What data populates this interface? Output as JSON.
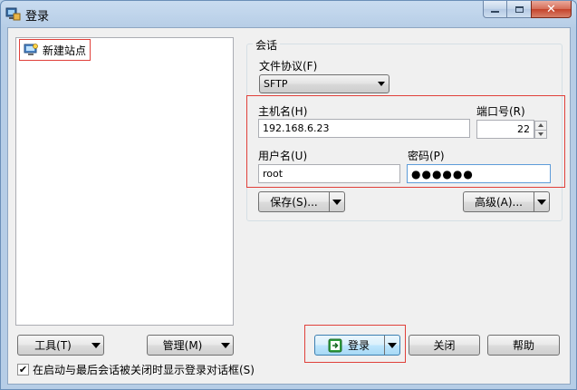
{
  "window": {
    "title": "登录"
  },
  "sites": {
    "new_site_label": "新建站点"
  },
  "session": {
    "group_label": "会话",
    "protocol_label": "文件协议(F)",
    "protocol_value": "SFTP",
    "host_label": "主机名(H)",
    "host_value": "192.168.6.23",
    "port_label": "端口号(R)",
    "port_value": "22",
    "user_label": "用户名(U)",
    "user_value": "root",
    "password_label": "密码(P)",
    "password_value": "●●●●●●",
    "save_label": "保存(S)...",
    "advanced_label": "高级(A)..."
  },
  "bottom": {
    "tools_label": "工具(T)",
    "manage_label": "管理(M)",
    "login_label": "登录",
    "close_label": "关闭",
    "help_label": "帮助",
    "checkbox_label": "在启动与最后会话被关闭时显示登录对话框(S)",
    "checkbox_checked": true
  },
  "colors": {
    "highlight": "#e0403a",
    "focus": "#5d9cd9",
    "accent": "#3c7fb1"
  }
}
